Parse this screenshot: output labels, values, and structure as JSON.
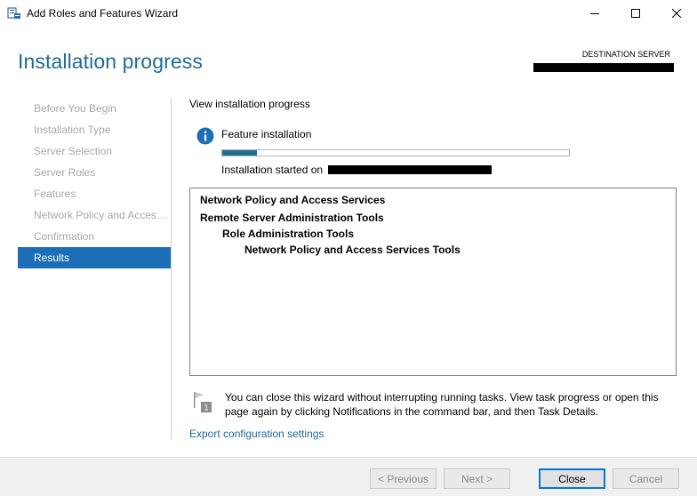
{
  "window": {
    "title": "Add Roles and Features Wizard"
  },
  "header": {
    "page_title": "Installation progress",
    "destination_label": "DESTINATION SERVER"
  },
  "nav": {
    "items": [
      {
        "label": "Before You Begin",
        "active": false
      },
      {
        "label": "Installation Type",
        "active": false
      },
      {
        "label": "Server Selection",
        "active": false
      },
      {
        "label": "Server Roles",
        "active": false
      },
      {
        "label": "Features",
        "active": false
      },
      {
        "label": "Network Policy and Access Services",
        "active": false
      },
      {
        "label": "Confirmation",
        "active": false
      },
      {
        "label": "Results",
        "active": true
      }
    ]
  },
  "content": {
    "view_title": "View installation progress",
    "feature_label": "Feature installation",
    "progress_fraction": 0.1,
    "started_label": "Installation started on",
    "results": [
      {
        "label": "Network Policy and Access Services",
        "level": 0
      },
      {
        "label": "Remote Server Administration Tools",
        "level": 0
      },
      {
        "label": "Role Administration Tools",
        "level": 1
      },
      {
        "label": "Network Policy and Access Services Tools",
        "level": 2
      }
    ],
    "note": "You can close this wizard without interrupting running tasks. View task progress or open this page again by clicking Notifications in the command bar, and then Task Details.",
    "export_link": "Export configuration settings",
    "flag_badge": "1"
  },
  "footer": {
    "previous_label": "< Previous",
    "next_label": "Next >",
    "close_label": "Close",
    "cancel_label": "Cancel"
  },
  "colors": {
    "accent": "#1c6fb6",
    "title": "#1e6a9a",
    "progress": "#1f708c"
  }
}
